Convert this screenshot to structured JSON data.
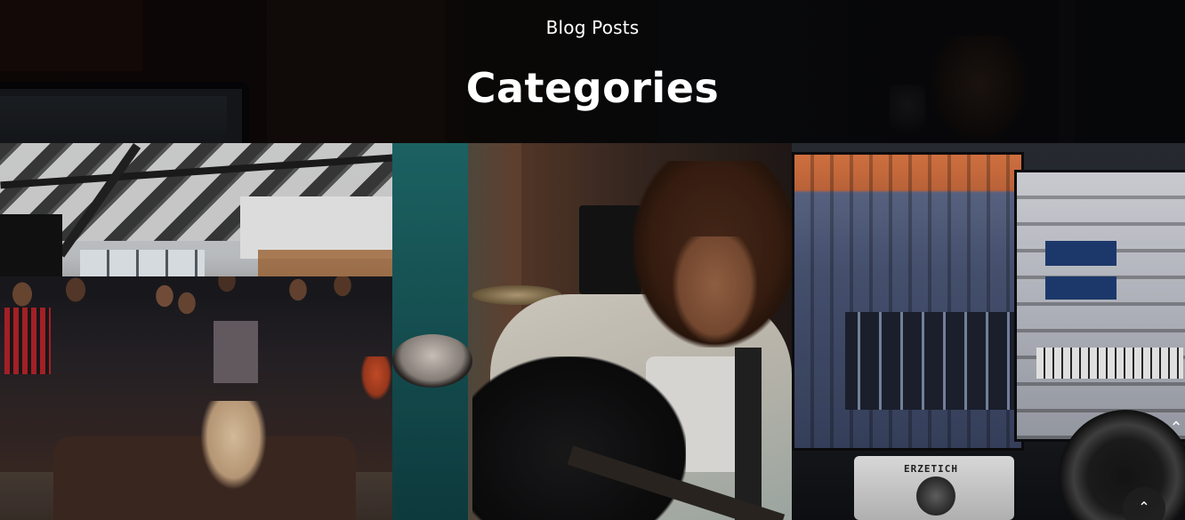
{
  "header": {
    "eyebrow": "Blog Posts",
    "title": "Categories"
  },
  "categories": [
    {
      "image": "event-crowd-photo"
    },
    {
      "image": "woman-playing-guitar-photo"
    },
    {
      "image": "music-production-screens-photo"
    }
  ],
  "device_label": "ERZETICH",
  "controls": {
    "side_arrow_icon": "chevron-up-icon",
    "scroll_top_icon": "chevron-up-icon"
  },
  "colors": {
    "heading_text": "#ffffff",
    "overlay": "#000000"
  }
}
